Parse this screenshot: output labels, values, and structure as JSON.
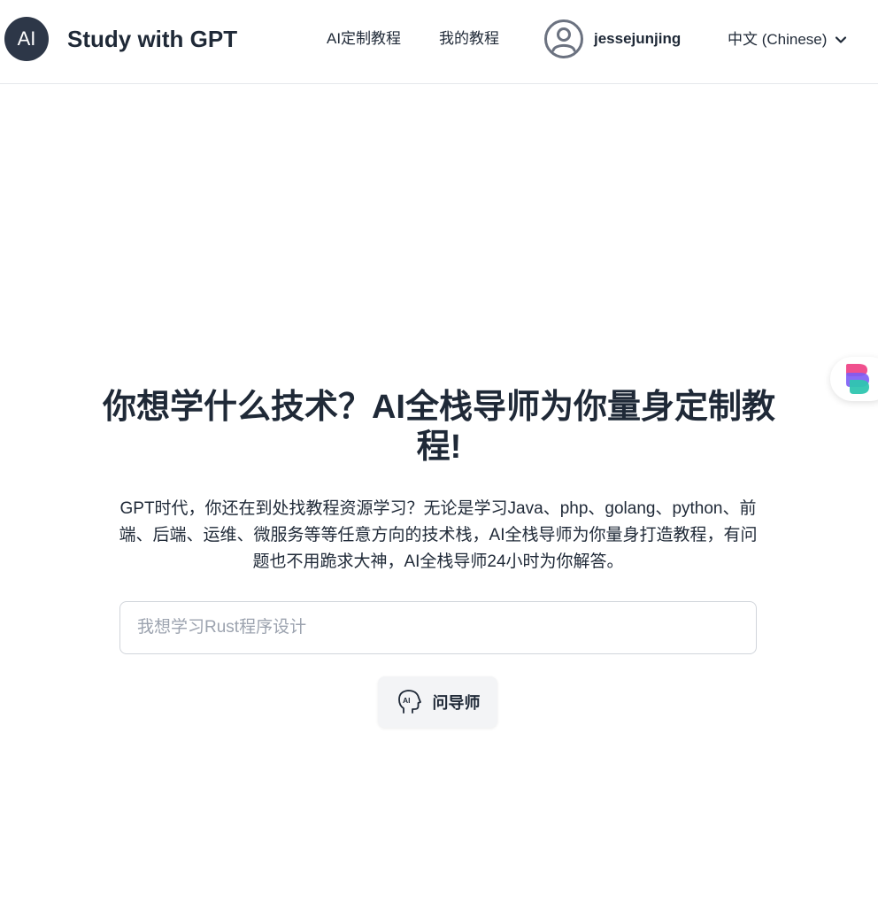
{
  "header": {
    "logo_text": "AI",
    "title": "Study with GPT",
    "nav": {
      "custom_tutorial": "AI定制教程",
      "my_tutorials": "我的教程"
    },
    "user": {
      "name": "jessejunjing",
      "avatar_icon": "user-circle-icon"
    },
    "language": {
      "selected": "中文 (Chinese)",
      "icon": "chevron-down-icon"
    }
  },
  "hero": {
    "title": "你想学什么技术？AI全栈导师为你量身定制教程!",
    "description": "GPT时代，你还在到处找教程资源学习？无论是学习Java、php、golang、python、前端、后端、运维、微服务等等任意方向的技术栈，AI全栈导师为你量身打造教程，有问题也不用跪求大神，AI全栈导师24小时为你解答。"
  },
  "search": {
    "placeholder": "我想学习Rust程序设计",
    "value": ""
  },
  "ask_button": {
    "label": "问导师",
    "icon": "ai-head-icon"
  },
  "side_widget": {
    "icon": "app-logo-icon"
  },
  "colors": {
    "logo_bg": "#2d3748",
    "text": "#1f2937",
    "border": "#e5e7eb",
    "button_bg": "#f3f4f6"
  }
}
